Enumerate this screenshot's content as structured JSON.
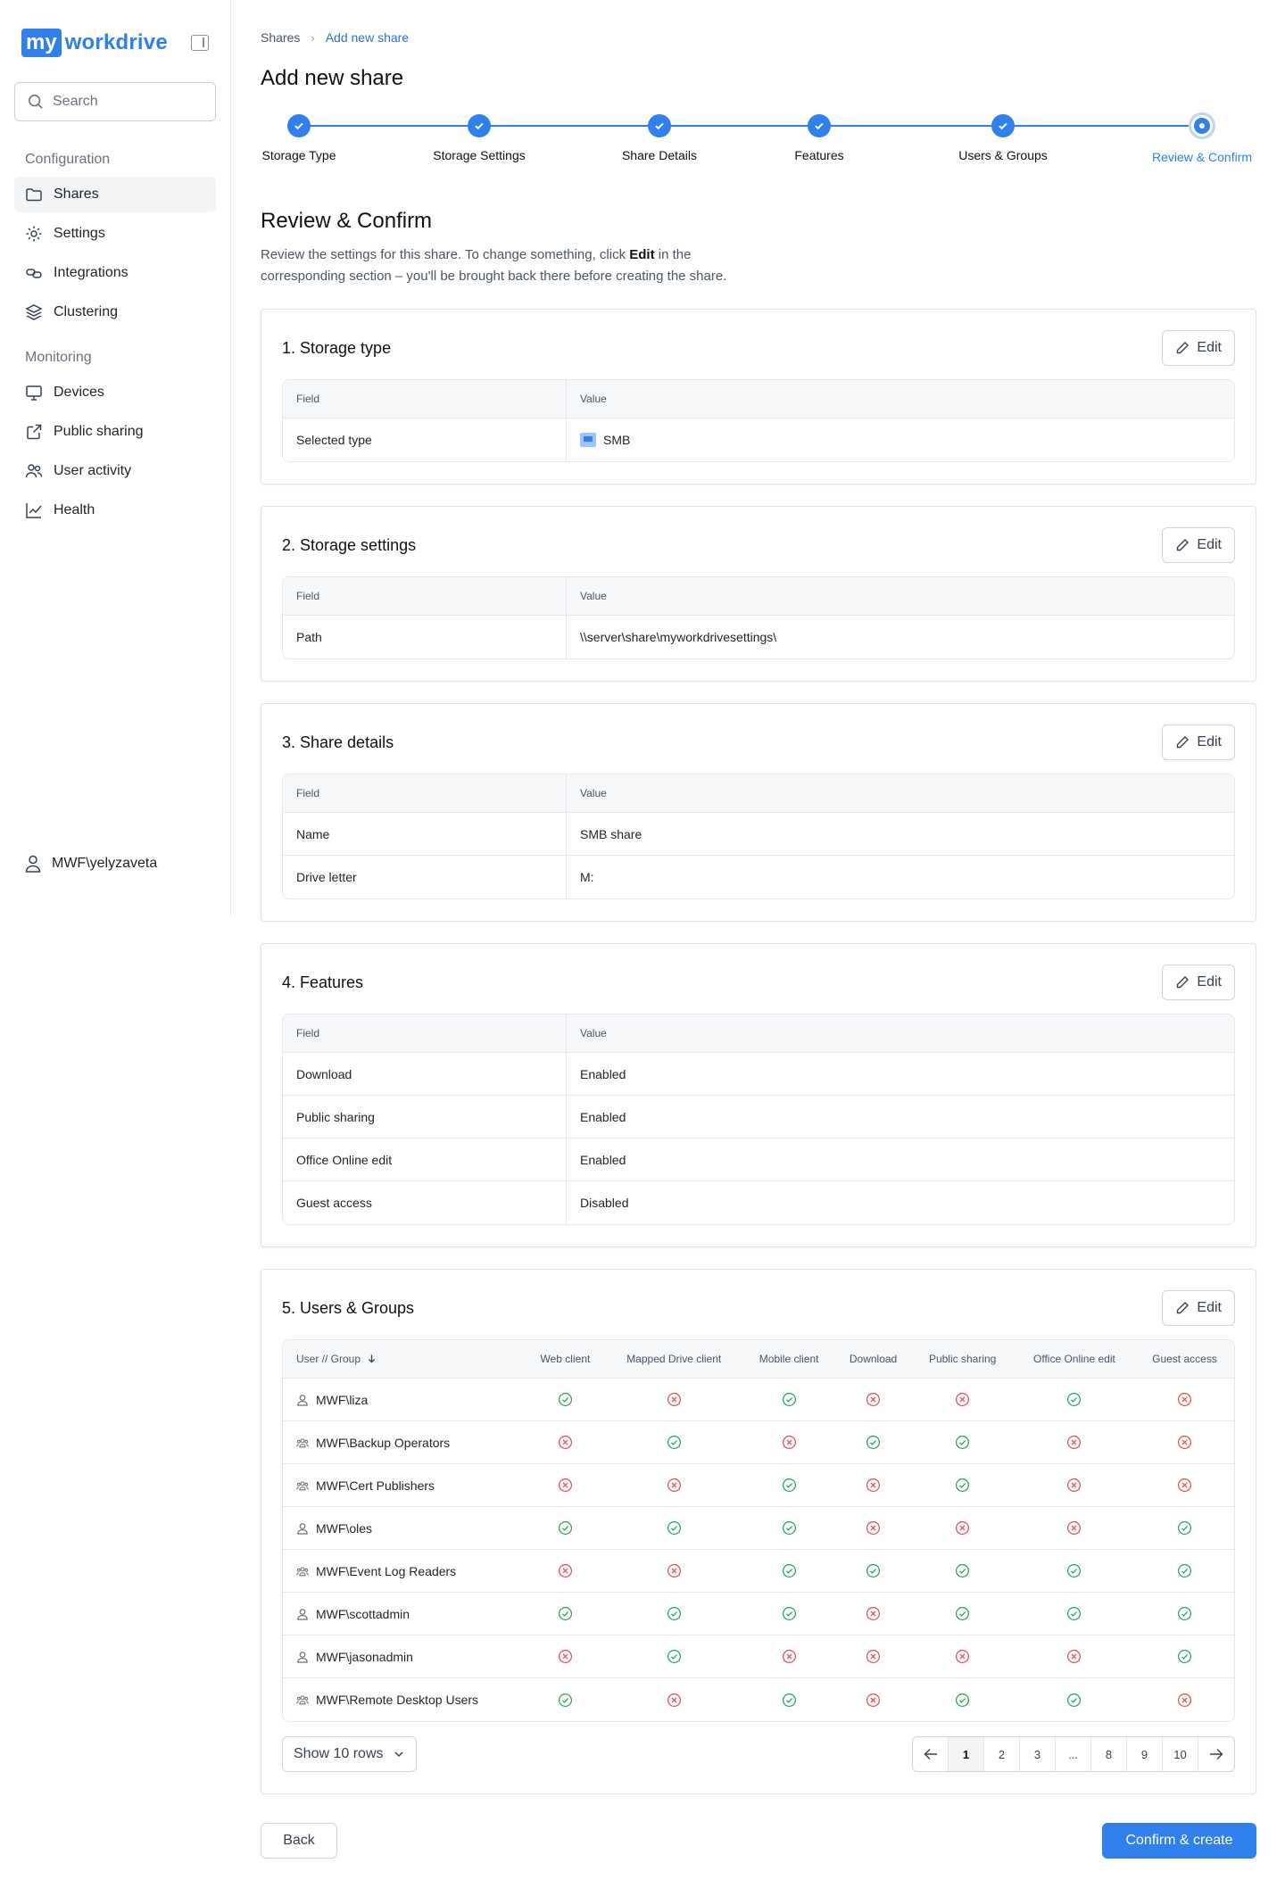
{
  "brand": {
    "logo_my": "my",
    "logo_rest": "workdrive"
  },
  "sidebar": {
    "search_placeholder": "Search",
    "config_label": "Configuration",
    "config_items": [
      {
        "label": "Shares",
        "icon": "folder-icon"
      },
      {
        "label": "Settings",
        "icon": "gear-icon"
      },
      {
        "label": "Integrations",
        "icon": "link-icon"
      },
      {
        "label": "Clustering",
        "icon": "layers-icon"
      }
    ],
    "monitor_label": "Monitoring",
    "monitor_items": [
      {
        "label": "Devices",
        "icon": "monitor-icon"
      },
      {
        "label": "Public sharing",
        "icon": "share-icon"
      },
      {
        "label": "User activity",
        "icon": "users-icon"
      },
      {
        "label": "Health",
        "icon": "chart-icon"
      }
    ],
    "user": "MWF\\yelyzaveta"
  },
  "breadcrumb": {
    "root": "Shares",
    "current": "Add new share"
  },
  "page_title": "Add new share",
  "steps": [
    "Storage Type",
    "Storage Settings",
    "Share Details",
    "Features",
    "Users & Groups",
    "Review & Confirm"
  ],
  "review": {
    "title": "Review & Confirm",
    "intro_a": "Review the settings for this share. To change something, click ",
    "intro_b": "Edit",
    "intro_c": " in the corresponding section – you'll be brought back there before creating the share."
  },
  "edit_label": "Edit",
  "col_field": "Field",
  "col_value": "Value",
  "sections": [
    {
      "title": "1. Storage type",
      "rows": [
        [
          "Selected type",
          "SMB"
        ]
      ]
    },
    {
      "title": "2. Storage settings",
      "rows": [
        [
          "Path",
          "\\\\server\\share\\myworkdrivesettings\\"
        ]
      ]
    },
    {
      "title": "3. Share details",
      "rows": [
        [
          "Name",
          "SMB share"
        ],
        [
          "Drive letter",
          "M:"
        ]
      ]
    },
    {
      "title": "4. Features",
      "rows": [
        [
          "Download",
          "Enabled"
        ],
        [
          "Public sharing",
          "Enabled"
        ],
        [
          "Office Online edit",
          "Enabled"
        ],
        [
          "Guest access",
          "Disabled"
        ]
      ]
    }
  ],
  "users_groups": {
    "title": "5. Users & Groups",
    "columns": [
      "User // Group",
      "Web client",
      "Mapped Drive client",
      "Mobile client",
      "Download",
      "Public sharing",
      "Office Online edit",
      "Guest access"
    ],
    "rows": [
      {
        "name": "MWF\\liza",
        "type": "user",
        "perms": [
          1,
          0,
          1,
          0,
          0,
          1,
          0
        ]
      },
      {
        "name": "MWF\\Backup Operators",
        "type": "group",
        "perms": [
          0,
          1,
          0,
          1,
          1,
          0,
          0
        ]
      },
      {
        "name": "MWF\\Cert Publishers",
        "type": "group",
        "perms": [
          0,
          0,
          1,
          0,
          1,
          0,
          0
        ]
      },
      {
        "name": "MWF\\oles",
        "type": "user",
        "perms": [
          1,
          1,
          1,
          0,
          0,
          0,
          1
        ]
      },
      {
        "name": "MWF\\Event Log Readers",
        "type": "group",
        "perms": [
          0,
          0,
          1,
          1,
          1,
          1,
          1
        ]
      },
      {
        "name": "MWF\\scottadmin",
        "type": "user",
        "perms": [
          1,
          1,
          1,
          0,
          1,
          1,
          1
        ]
      },
      {
        "name": "MWF\\jasonadmin",
        "type": "user",
        "perms": [
          0,
          1,
          0,
          0,
          0,
          0,
          1
        ]
      },
      {
        "name": "MWF\\Remote Desktop Users",
        "type": "group",
        "perms": [
          1,
          0,
          1,
          0,
          1,
          1,
          0
        ]
      }
    ],
    "rows_selector": "Show 10 rows",
    "pages": [
      "1",
      "2",
      "3",
      "...",
      "8",
      "9",
      "10"
    ],
    "current_page": "1"
  },
  "footer": {
    "back": "Back",
    "confirm": "Confirm & create"
  },
  "colors": {
    "accent": "#2f80ed",
    "ok": "#22a05b",
    "no": "#e5484d"
  }
}
